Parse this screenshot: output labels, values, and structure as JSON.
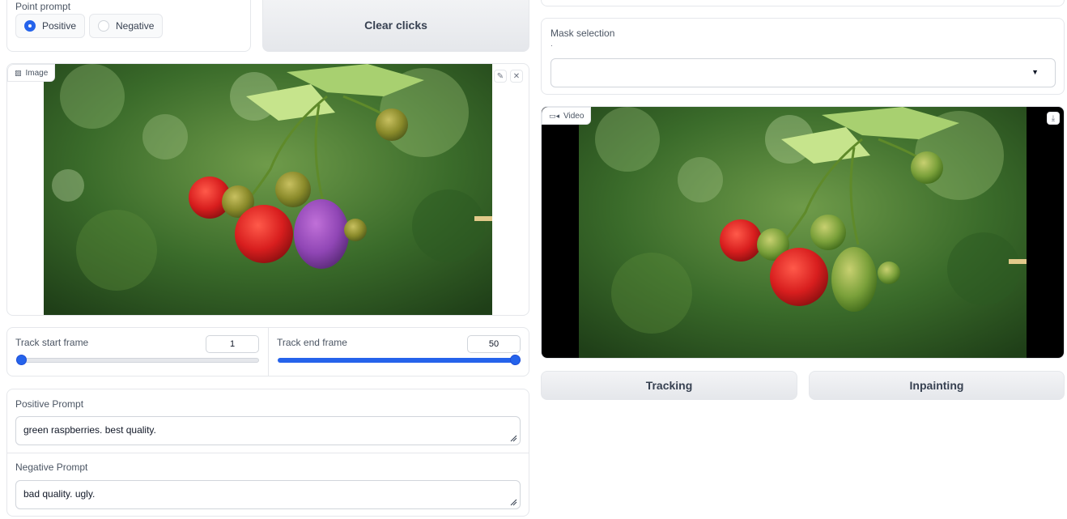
{
  "point_prompt": {
    "label": "Point prompt",
    "options": [
      {
        "label": "Positive",
        "selected": true
      },
      {
        "label": "Negative",
        "selected": false
      }
    ]
  },
  "clear_clicks_label": "Clear clicks",
  "image_panel": {
    "tag_label": "Image",
    "icons": [
      "image-icon",
      "edit-icon",
      "close-icon"
    ]
  },
  "sliders": {
    "start": {
      "label": "Track start frame",
      "value": "1",
      "fraction": 0.0
    },
    "end": {
      "label": "Track end frame",
      "value": "50",
      "fraction": 1.0
    }
  },
  "positive_prompt": {
    "label": "Positive Prompt",
    "value": "green raspberries. best quality."
  },
  "negative_prompt": {
    "label": "Negative Prompt",
    "value": "bad quality. ugly."
  },
  "mask_selection": {
    "label": "Mask selection",
    "info": ".",
    "value": ""
  },
  "video_panel": {
    "tag_label": "Video",
    "icons": [
      "video-icon",
      "download-icon"
    ]
  },
  "buttons": {
    "tracking": "Tracking",
    "inpainting": "Inpainting"
  },
  "colors": {
    "accent": "#2563eb",
    "border": "#e5e7eb",
    "button_bg": "#eceef1",
    "black_bar": "#000000"
  }
}
